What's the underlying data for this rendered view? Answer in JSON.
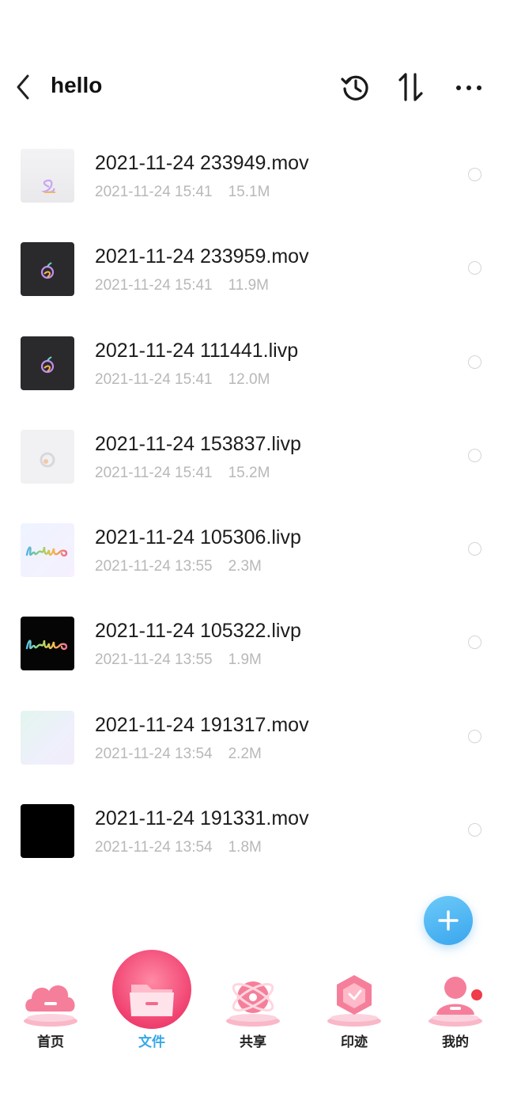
{
  "header": {
    "back_icon": "chevron-left-icon",
    "title": "hello",
    "actions": [
      {
        "name": "history-icon"
      },
      {
        "name": "sort-icon"
      },
      {
        "name": "more-icon"
      }
    ]
  },
  "files": [
    {
      "name": "2021-11-24 233949.mov",
      "date": "2021-11-24 15:41",
      "size": "15.1M",
      "thumb": "light-silk"
    },
    {
      "name": "2021-11-24 233959.mov",
      "date": "2021-11-24 15:41",
      "size": "11.9M",
      "thumb": "dark-apple"
    },
    {
      "name": "2021-11-24 111441.livp",
      "date": "2021-11-24 15:41",
      "size": "12.0M",
      "thumb": "dark-apple"
    },
    {
      "name": "2021-11-24 153837.livp",
      "date": "2021-11-24 15:41",
      "size": "15.2M",
      "thumb": "light-apple"
    },
    {
      "name": "2021-11-24 105306.livp",
      "date": "2021-11-24 13:55",
      "size": "2.3M",
      "thumb": "hello-light"
    },
    {
      "name": "2021-11-24 105322.livp",
      "date": "2021-11-24 13:55",
      "size": "1.9M",
      "thumb": "hello-dark"
    },
    {
      "name": "2021-11-24 191317.mov",
      "date": "2021-11-24 13:54",
      "size": "2.2M",
      "thumb": "gradient-light"
    },
    {
      "name": "2021-11-24 191331.mov",
      "date": "2021-11-24 13:54",
      "size": "1.8M",
      "thumb": "black"
    }
  ],
  "fab": {
    "icon": "plus-icon"
  },
  "tabs": [
    {
      "label": "首页",
      "icon": "cloud-icon",
      "active": false
    },
    {
      "label": "文件",
      "icon": "folder-icon",
      "active": true
    },
    {
      "label": "共享",
      "icon": "atom-icon",
      "active": false
    },
    {
      "label": "印迹",
      "icon": "clock-icon",
      "active": false
    },
    {
      "label": "我的",
      "icon": "user-icon",
      "active": false
    }
  ],
  "colors": {
    "accent": "#34a8ea",
    "tab_pink": "#f26a8a",
    "meta_text": "#b8b8b8"
  }
}
